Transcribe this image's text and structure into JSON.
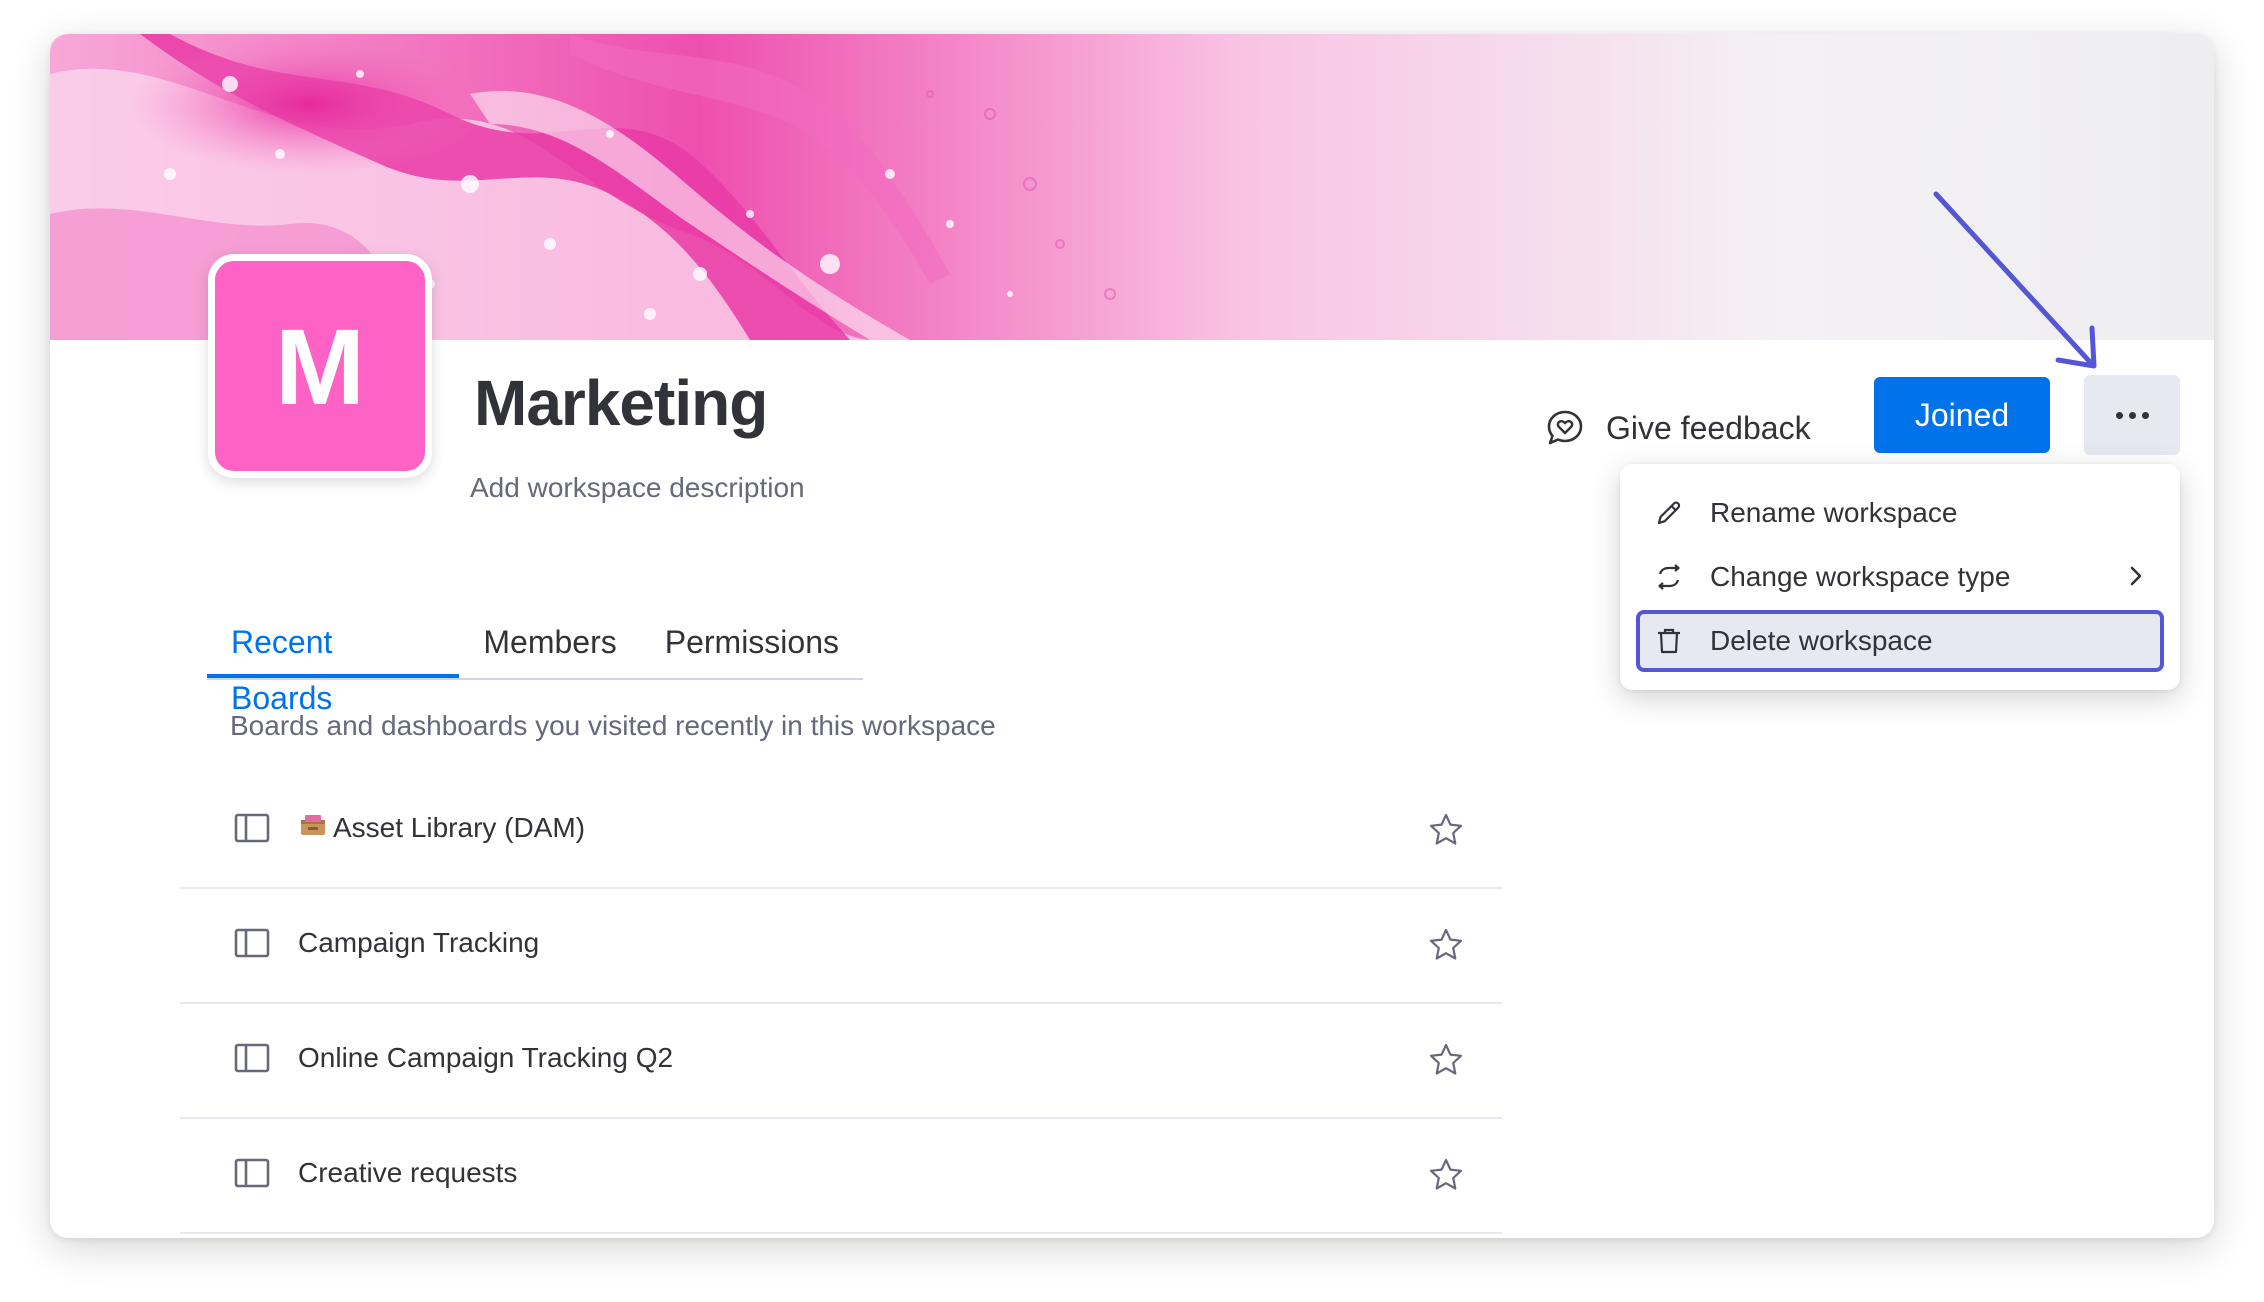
{
  "workspace": {
    "logo_letter": "M",
    "title": "Marketing",
    "description_placeholder": "Add workspace description",
    "feedback_label": "Give feedback",
    "joined_label": "Joined",
    "brand_color": "#fd62c4",
    "primary_color": "#0073ea"
  },
  "tabs": [
    {
      "label": "Recent Boards",
      "active": true
    },
    {
      "label": "Members",
      "active": false
    },
    {
      "label": "Permissions",
      "active": false
    }
  ],
  "recent_note": "Boards and dashboards you visited recently in this workspace",
  "boards": [
    {
      "name": "Asset Library (DAM)",
      "emoji": "card-file-box"
    },
    {
      "name": "Campaign Tracking"
    },
    {
      "name": "Online Campaign Tracking Q2"
    },
    {
      "name": "Creative requests"
    }
  ],
  "menu": {
    "items": [
      {
        "label": "Rename workspace",
        "icon": "pencil-icon"
      },
      {
        "label": "Change workspace type",
        "icon": "swap-icon",
        "has_submenu": true
      },
      {
        "label": "Delete workspace",
        "icon": "trash-icon",
        "highlighted": true
      }
    ]
  },
  "annotation": {
    "arrow_color": "#5456d6"
  }
}
